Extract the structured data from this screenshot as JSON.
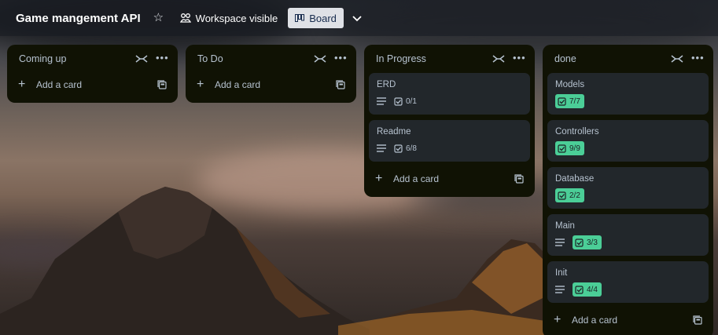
{
  "board": {
    "title": "Game mangement API",
    "visibility_label": "Workspace visible",
    "view_label": "Board"
  },
  "icons": {
    "star": "star-icon",
    "visibility": "workspace-icon",
    "board_view": "board-icon",
    "dropdown": "chevron-down-icon",
    "collapse": "collapse-icon",
    "more": "more-icon",
    "description": "description-icon",
    "checklist": "checklist-icon",
    "add": "plus-icon",
    "template": "template-icon"
  },
  "colors": {
    "list_bg": "#101204",
    "card_bg": "#22272b",
    "complete_badge": "#4bce97",
    "text": "#b6c2cf"
  },
  "add_card_label": "Add a card",
  "lists": [
    {
      "title": "Coming up",
      "cards": []
    },
    {
      "title": "To Do",
      "cards": []
    },
    {
      "title": "In Progress",
      "cards": [
        {
          "title": "ERD",
          "has_description": true,
          "checklist": "0/1",
          "complete": false
        },
        {
          "title": "Readme",
          "has_description": true,
          "checklist": "6/8",
          "complete": false
        }
      ]
    },
    {
      "title": "done",
      "cards": [
        {
          "title": "Models",
          "has_description": false,
          "checklist": "7/7",
          "complete": true
        },
        {
          "title": "Controllers",
          "has_description": false,
          "checklist": "9/9",
          "complete": true
        },
        {
          "title": "Database",
          "has_description": false,
          "checklist": "2/2",
          "complete": true
        },
        {
          "title": "Main",
          "has_description": true,
          "checklist": "3/3",
          "complete": true
        },
        {
          "title": "Init",
          "has_description": true,
          "checklist": "4/4",
          "complete": true
        }
      ]
    }
  ]
}
